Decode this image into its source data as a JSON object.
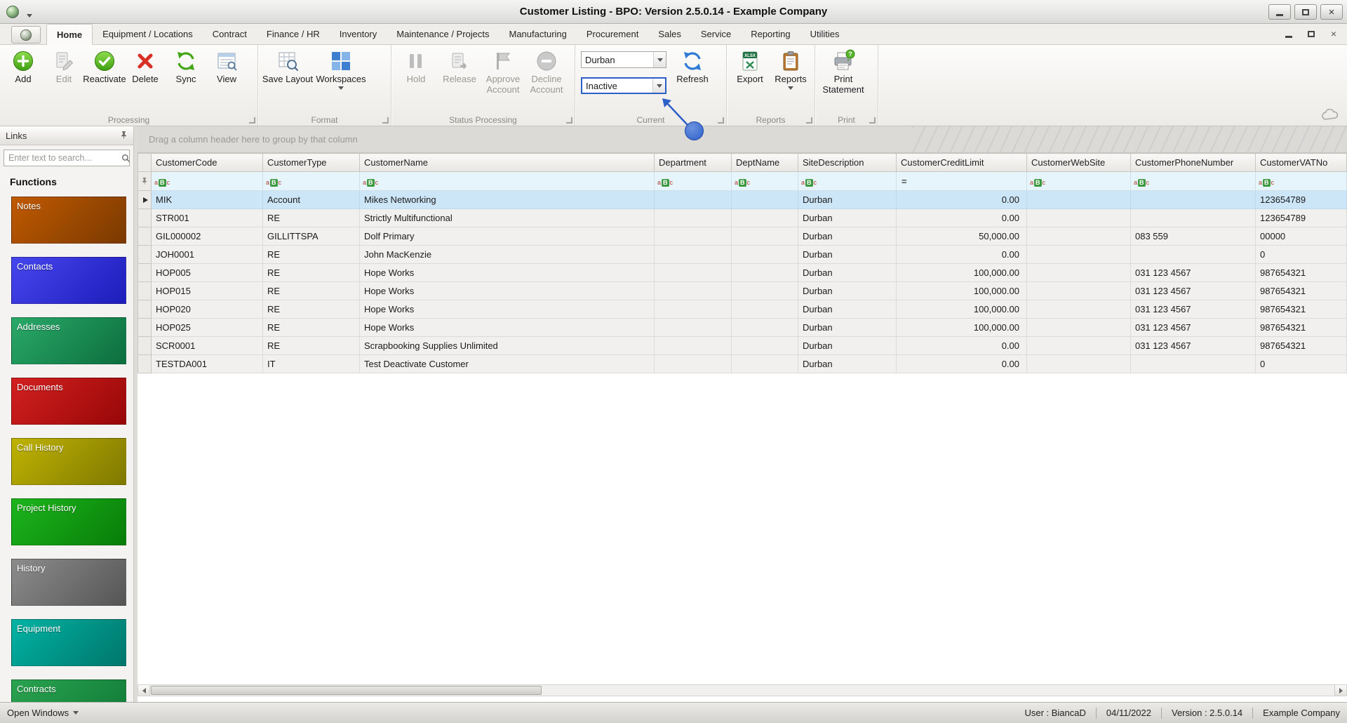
{
  "window": {
    "title": "Customer Listing - BPO: Version 2.5.0.14 - Example Company"
  },
  "tabs": [
    {
      "label": "Home",
      "active": true
    },
    {
      "label": "Equipment / Locations"
    },
    {
      "label": "Contract"
    },
    {
      "label": "Finance / HR"
    },
    {
      "label": "Inventory"
    },
    {
      "label": "Maintenance / Projects"
    },
    {
      "label": "Manufacturing"
    },
    {
      "label": "Procurement"
    },
    {
      "label": "Sales"
    },
    {
      "label": "Service"
    },
    {
      "label": "Reporting"
    },
    {
      "label": "Utilities"
    }
  ],
  "ribbon": {
    "groups": [
      {
        "label": "Processing",
        "buttons": [
          {
            "label": "Add",
            "icon": "add-icon",
            "enabled": true
          },
          {
            "label": "Edit",
            "icon": "edit-icon",
            "enabled": false
          },
          {
            "label": "Reactivate",
            "icon": "reactivate-icon",
            "enabled": true
          },
          {
            "label": "Delete",
            "icon": "delete-icon",
            "enabled": true
          },
          {
            "label": "Sync",
            "icon": "sync-icon",
            "enabled": true
          },
          {
            "label": "View",
            "icon": "view-icon",
            "enabled": true
          }
        ]
      },
      {
        "label": "Format",
        "wide": true,
        "buttons": [
          {
            "label": "Save Layout",
            "icon": "save-layout-icon",
            "enabled": true
          },
          {
            "label": "Workspaces",
            "icon": "workspaces-icon",
            "enabled": true,
            "dropdown": true
          }
        ]
      },
      {
        "label": "Status Processing",
        "buttons": [
          {
            "label": "Hold",
            "icon": "hold-icon",
            "enabled": false
          },
          {
            "label": "Release",
            "icon": "release-icon",
            "enabled": false
          },
          {
            "label": "Approve Account",
            "icon": "approve-account-icon",
            "enabled": false
          },
          {
            "label": "Decline Account",
            "icon": "decline-account-icon",
            "enabled": false
          }
        ]
      },
      {
        "label": "Current",
        "combos": [
          {
            "name": "current-site",
            "value": "Durban"
          },
          {
            "name": "current-status",
            "value": "Inactive",
            "focused": true
          }
        ],
        "buttons": [
          {
            "label": "Refresh",
            "icon": "refresh-icon",
            "enabled": true
          }
        ]
      },
      {
        "label": "Reports",
        "buttons": [
          {
            "label": "Export",
            "icon": "export-icon",
            "enabled": true
          },
          {
            "label": "Reports",
            "icon": "reports-icon",
            "enabled": true,
            "dropdown": true
          }
        ]
      },
      {
        "label": "Print",
        "buttons": [
          {
            "label": "Print Statement",
            "icon": "print-statement-icon",
            "enabled": true
          }
        ]
      }
    ]
  },
  "sidebar": {
    "title": "Links",
    "search_placeholder": "Enter text to search...",
    "functions_label": "Functions",
    "items": [
      {
        "label": "Notes",
        "color_from": "#c05a00",
        "color_to": "#7a3900"
      },
      {
        "label": "Contacts",
        "color_from": "#4646ee",
        "color_to": "#1d1dbb"
      },
      {
        "label": "Addresses",
        "color_from": "#2aa968",
        "color_to": "#0c6e3e"
      },
      {
        "label": "Documents",
        "color_from": "#d32020",
        "color_to": "#970707"
      },
      {
        "label": "Call History",
        "color_from": "#bfb303",
        "color_to": "#7f7800"
      },
      {
        "label": "Project History",
        "color_from": "#1db51d",
        "color_to": "#077d07"
      },
      {
        "label": "History",
        "color_from": "#8c8c8c",
        "color_to": "#555555"
      },
      {
        "label": "Equipment",
        "color_from": "#00b3a4",
        "color_to": "#00766b"
      },
      {
        "label": "Contracts",
        "color_from": "#2aa34f",
        "color_to": "#107a37"
      }
    ]
  },
  "grid": {
    "group_hint": "Drag a column header here to group by that column",
    "columns": [
      {
        "label": "CustomerCode",
        "filter": "abc"
      },
      {
        "label": "CustomerType",
        "filter": "abc"
      },
      {
        "label": "CustomerName",
        "filter": "abc"
      },
      {
        "label": "Department",
        "filter": "abc"
      },
      {
        "label": "DeptName",
        "filter": "abc"
      },
      {
        "label": "SiteDescription",
        "filter": "abc"
      },
      {
        "label": "CustomerCreditLimit",
        "filter": "eq",
        "align": "right"
      },
      {
        "label": "CustomerWebSite",
        "filter": "abc"
      },
      {
        "label": "CustomerPhoneNumber",
        "filter": "abc"
      },
      {
        "label": "CustomerVATNo",
        "filter": "abc"
      }
    ],
    "rows": [
      {
        "selected": true,
        "cells": [
          "MIK",
          "Account",
          "Mikes Networking",
          "",
          "",
          "Durban",
          "0.00",
          "",
          "",
          "123654789"
        ]
      },
      {
        "cells": [
          "STR001",
          "RE",
          "Strictly Multifunctional",
          "",
          "",
          "Durban",
          "0.00",
          "",
          "",
          "123654789"
        ]
      },
      {
        "cells": [
          "GIL000002",
          "GILLITTSPA",
          "Dolf Primary",
          "",
          "",
          "Durban",
          "50,000.00",
          "",
          "083 559",
          "00000"
        ]
      },
      {
        "cells": [
          "JOH0001",
          "RE",
          "John MacKenzie",
          "",
          "",
          "Durban",
          "0.00",
          "",
          "",
          "0"
        ]
      },
      {
        "cells": [
          "HOP005",
          "RE",
          "Hope Works",
          "",
          "",
          "Durban",
          "100,000.00",
          "",
          "031 123 4567",
          "987654321"
        ]
      },
      {
        "cells": [
          "HOP015",
          "RE",
          "Hope Works",
          "",
          "",
          "Durban",
          "100,000.00",
          "",
          "031 123 4567",
          "987654321"
        ]
      },
      {
        "cells": [
          "HOP020",
          "RE",
          "Hope Works",
          "",
          "",
          "Durban",
          "100,000.00",
          "",
          "031 123 4567",
          "987654321"
        ]
      },
      {
        "cells": [
          "HOP025",
          "RE",
          "Hope Works",
          "",
          "",
          "Durban",
          "100,000.00",
          "",
          "031 123 4567",
          "987654321"
        ]
      },
      {
        "cells": [
          "SCR0001",
          "RE",
          "Scrapbooking Supplies Unlimited",
          "",
          "",
          "Durban",
          "0.00",
          "",
          "031 123 4567",
          "987654321"
        ]
      },
      {
        "cells": [
          "TESTDA001",
          "IT",
          "Test Deactivate Customer",
          "",
          "",
          "Durban",
          "0.00",
          "",
          "",
          "0"
        ]
      }
    ]
  },
  "statusbar": {
    "open_windows": "Open Windows",
    "user": "User : BiancaD",
    "date": "04/11/2022",
    "version": "Version : 2.5.0.14",
    "company": "Example Company"
  },
  "colors": {
    "selection": "#cde6f7",
    "focus_accent": "#2d5fc7",
    "filter_row": "#e6f5fb"
  }
}
